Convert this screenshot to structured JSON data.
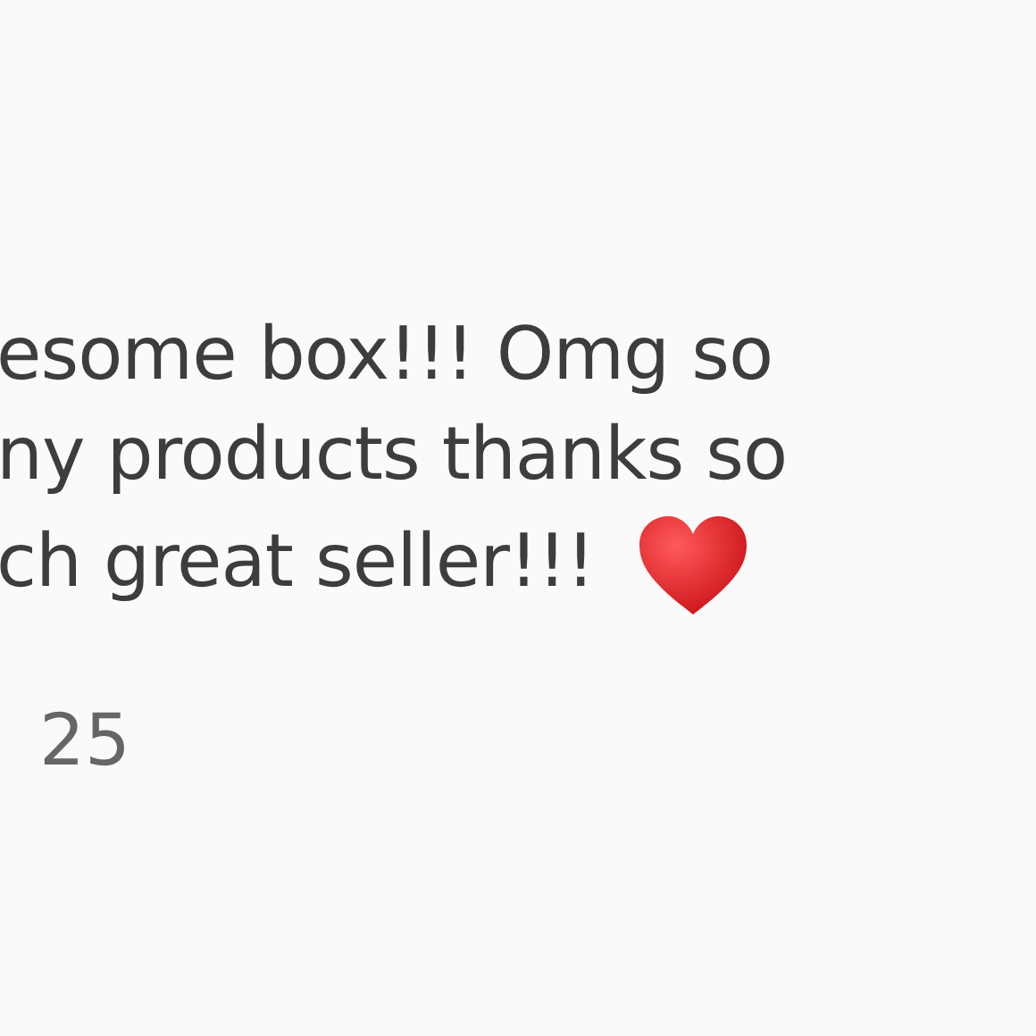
{
  "comment": {
    "lines": [
      "esome box!!! Omg so",
      "ny products thanks so",
      "ch great seller!!!"
    ],
    "date": "25"
  }
}
